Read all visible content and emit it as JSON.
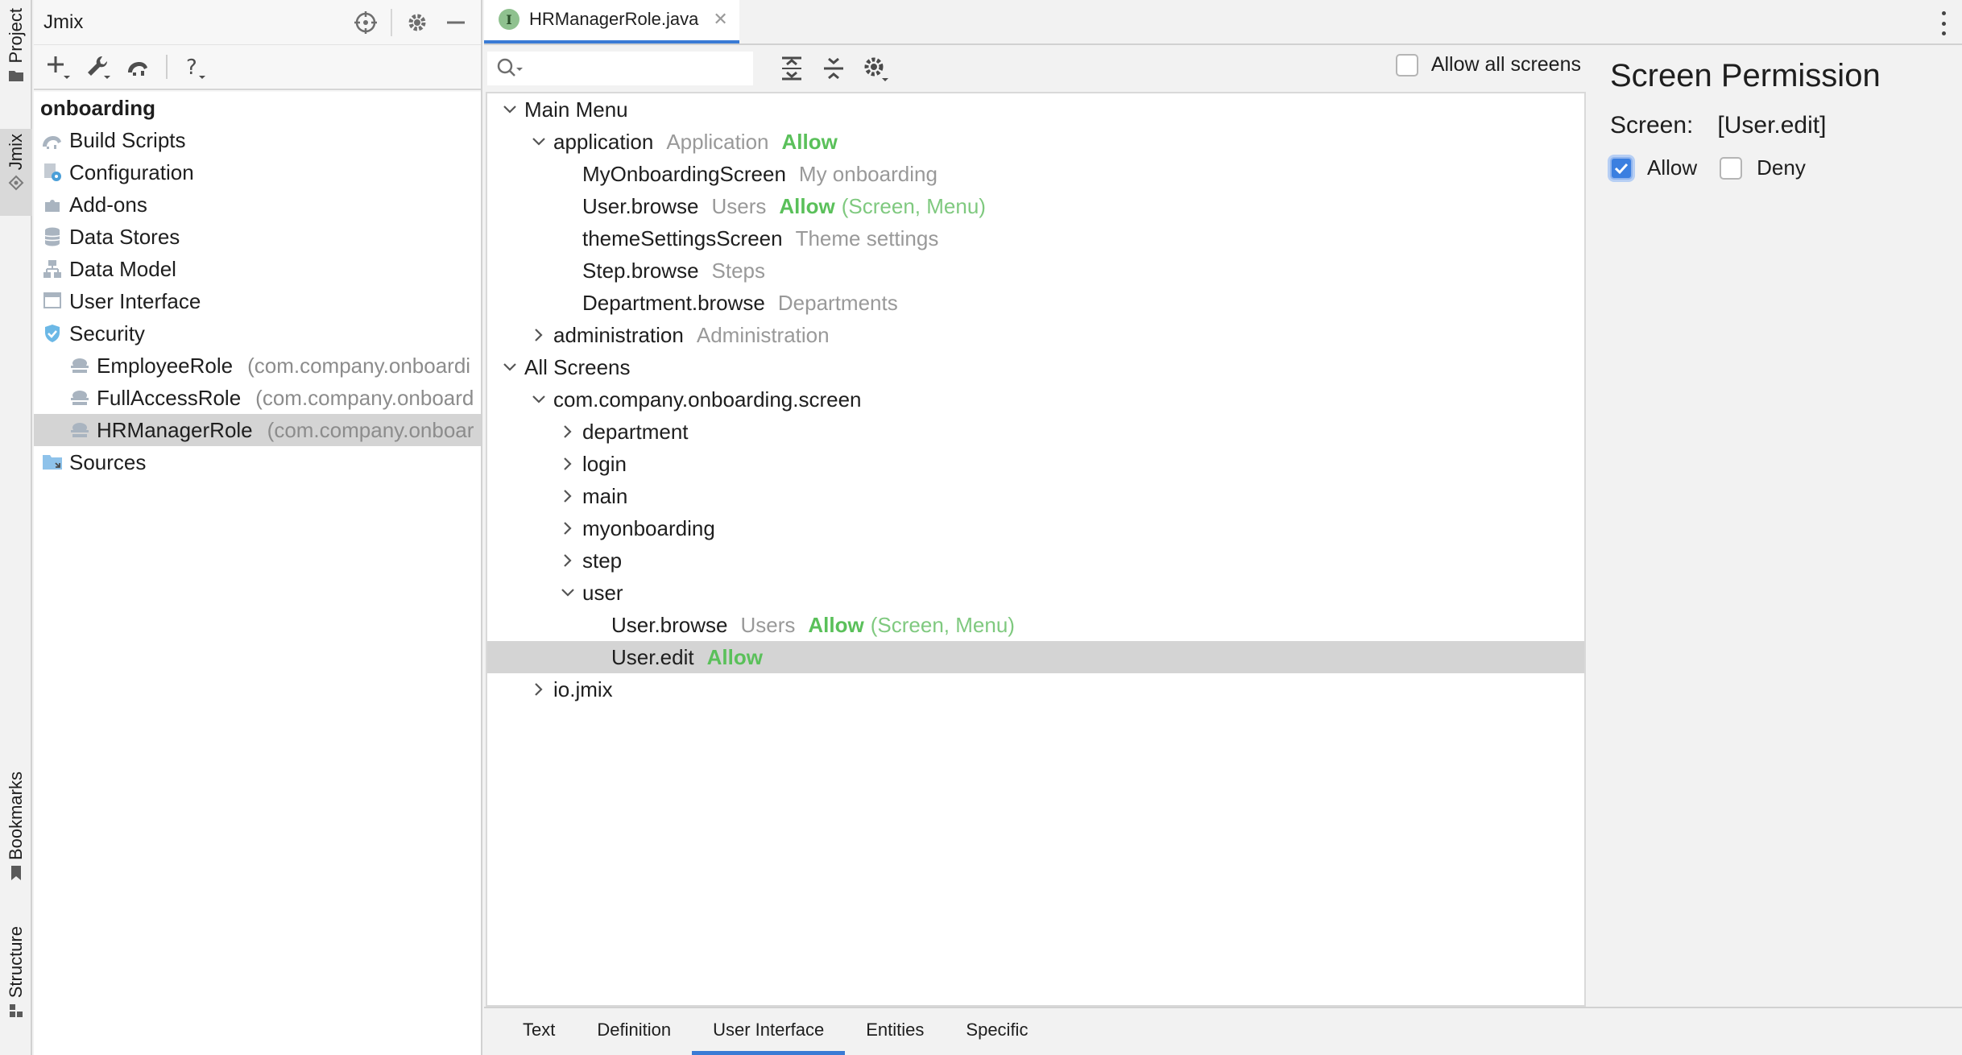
{
  "left_stripe": {
    "tabs": [
      {
        "label": "Project",
        "icon": "folder-icon"
      },
      {
        "label": "Jmix",
        "icon": "jmix-icon"
      },
      {
        "label": "Bookmarks",
        "icon": "bookmark-icon"
      },
      {
        "label": "Structure",
        "icon": "structure-icon"
      }
    ]
  },
  "project": {
    "title": "Jmix",
    "tree": [
      {
        "label": "onboarding",
        "level": 0,
        "icon": "none",
        "bold": true
      },
      {
        "label": "Build Scripts",
        "level": 1,
        "icon": "gradle-icon"
      },
      {
        "label": "Configuration",
        "level": 1,
        "icon": "configuration-icon"
      },
      {
        "label": "Add-ons",
        "level": 1,
        "icon": "addons-icon"
      },
      {
        "label": "Data Stores",
        "level": 1,
        "icon": "database-icon"
      },
      {
        "label": "Data Model",
        "level": 1,
        "icon": "data-model-icon"
      },
      {
        "label": "User Interface",
        "level": 1,
        "icon": "window-icon"
      },
      {
        "label": "Security",
        "level": 1,
        "icon": "shield-icon"
      },
      {
        "label": "EmployeeRole",
        "hint": "(com.company.onboardi",
        "level": 2,
        "icon": "role-icon"
      },
      {
        "label": "FullAccessRole",
        "hint": "(com.company.onboard",
        "level": 2,
        "icon": "role-icon"
      },
      {
        "label": "HRManagerRole",
        "hint": "(com.company.onboar",
        "level": 2,
        "icon": "role-icon",
        "selected": true
      },
      {
        "label": "Sources",
        "level": 1,
        "icon": "sources-folder-icon"
      }
    ]
  },
  "editor": {
    "tab_label": "HRManagerRole.java",
    "tab_icon_letter": "I",
    "allow_all_label": "Allow all screens",
    "tree": [
      {
        "label": "Main Menu",
        "level": 0,
        "chevron": "down"
      },
      {
        "label": "application",
        "caption": "Application",
        "allow": "Allow",
        "level": 1,
        "chevron": "down"
      },
      {
        "label": "MyOnboardingScreen",
        "caption": "My onboarding",
        "level": 2,
        "chevron": "none"
      },
      {
        "label": "User.browse",
        "caption": "Users",
        "allow": "Allow",
        "extra": "(Screen, Menu)",
        "level": 2,
        "chevron": "none"
      },
      {
        "label": "themeSettingsScreen",
        "caption": "Theme settings",
        "level": 2,
        "chevron": "none"
      },
      {
        "label": "Step.browse",
        "caption": "Steps",
        "level": 2,
        "chevron": "none"
      },
      {
        "label": "Department.browse",
        "caption": "Departments",
        "level": 2,
        "chevron": "none"
      },
      {
        "label": "administration",
        "caption": "Administration",
        "level": 1,
        "chevron": "right"
      },
      {
        "label": "All Screens",
        "level": 0,
        "chevron": "down"
      },
      {
        "label": "com.company.onboarding.screen",
        "level": 1,
        "chevron": "down"
      },
      {
        "label": "department",
        "level": 2,
        "chevron": "right"
      },
      {
        "label": "login",
        "level": 2,
        "chevron": "right"
      },
      {
        "label": "main",
        "level": 2,
        "chevron": "right"
      },
      {
        "label": "myonboarding",
        "level": 2,
        "chevron": "right"
      },
      {
        "label": "step",
        "level": 2,
        "chevron": "right"
      },
      {
        "label": "user",
        "level": 2,
        "chevron": "down"
      },
      {
        "label": "User.browse",
        "caption": "Users",
        "allow": "Allow",
        "extra": "(Screen, Menu)",
        "level": 3,
        "chevron": "none"
      },
      {
        "label": "User.edit",
        "allow": "Allow",
        "level": 3,
        "chevron": "none",
        "selected": true
      },
      {
        "label": "io.jmix",
        "level": 1,
        "chevron": "right"
      }
    ],
    "bottom_tabs": [
      {
        "label": "Text"
      },
      {
        "label": "Definition"
      },
      {
        "label": "User Interface",
        "active": true
      },
      {
        "label": "Entities"
      },
      {
        "label": "Specific"
      }
    ]
  },
  "permission": {
    "title": "Screen Permission",
    "screen_label": "Screen:",
    "screen_value": "[User.edit]",
    "allow_label": "Allow",
    "deny_label": "Deny",
    "allow_checked": true,
    "deny_checked": false
  },
  "colors": {
    "accent": "#3a7bd5",
    "allow_green": "#5ac05a",
    "caption_gray": "#999999",
    "selection": "#d4d4d4"
  }
}
